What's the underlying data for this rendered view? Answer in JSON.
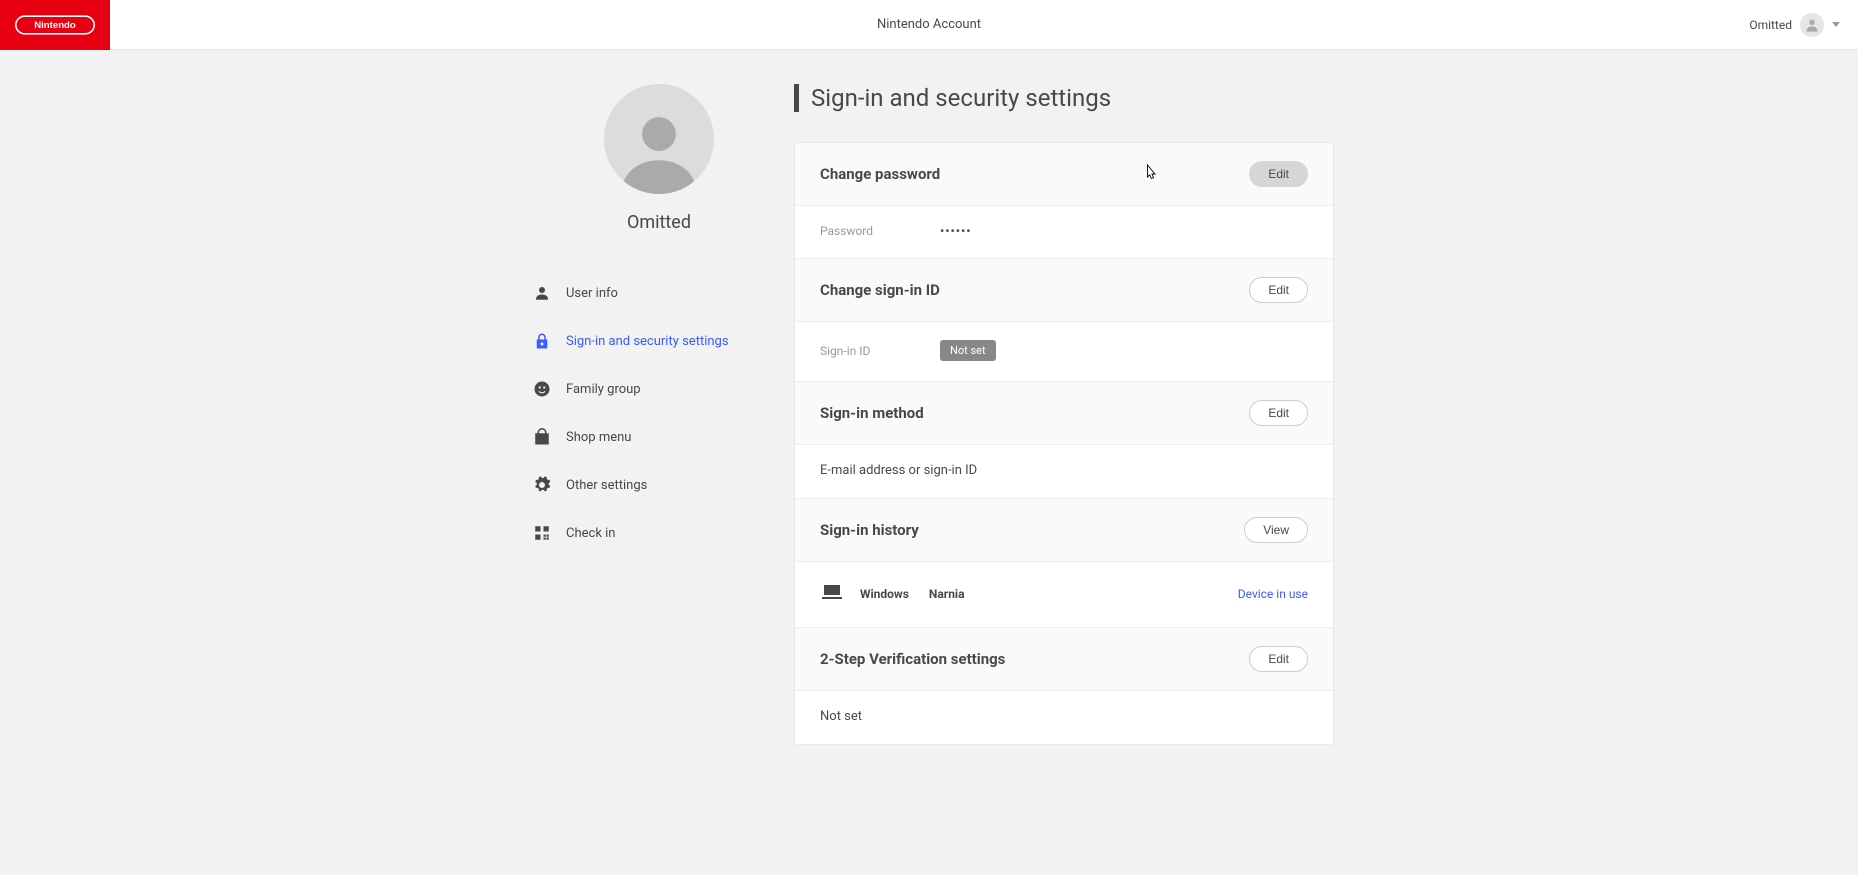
{
  "header": {
    "title": "Nintendo Account",
    "user_name": "Omitted"
  },
  "sidebar": {
    "display_name": "Omitted",
    "nav": {
      "user_info": "User info",
      "signin_security": "Sign-in and security settings",
      "family_group": "Family group",
      "shop_menu": "Shop menu",
      "other_settings": "Other settings",
      "check_in": "Check in"
    }
  },
  "main": {
    "heading": "Sign-in and security settings",
    "buttons": {
      "edit": "Edit",
      "view": "View"
    },
    "change_password": {
      "title": "Change password",
      "label": "Password",
      "value": "••••••"
    },
    "change_signin_id": {
      "title": "Change sign-in ID",
      "label": "Sign-in ID",
      "badge": "Not set"
    },
    "signin_method": {
      "title": "Sign-in method",
      "text": "E-mail address or sign-in ID"
    },
    "signin_history": {
      "title": "Sign-in history",
      "os": "Windows",
      "location": "Narnia",
      "status": "Device in use"
    },
    "two_step": {
      "title": "2-Step Verification settings",
      "text": "Not set"
    }
  }
}
